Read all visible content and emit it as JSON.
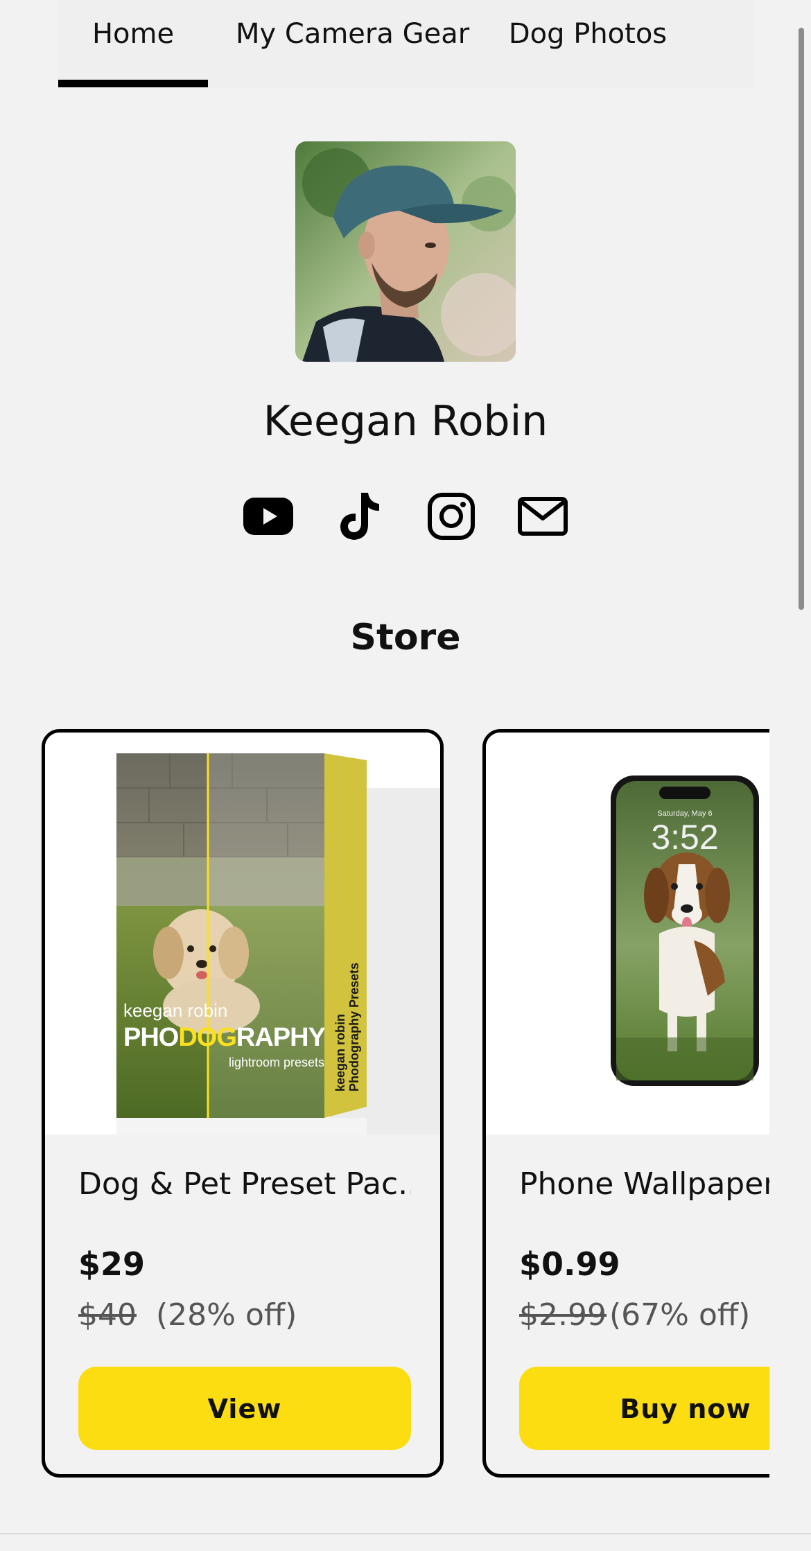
{
  "nav": {
    "tabs": [
      {
        "label": "Home",
        "active": true
      },
      {
        "label": "My Camera Gear",
        "active": false
      },
      {
        "label": "Dog Photos",
        "active": false
      }
    ]
  },
  "profile": {
    "name": "Keegan Robin",
    "socials": [
      "youtube-icon",
      "tiktok-icon",
      "instagram-icon",
      "mail-icon"
    ]
  },
  "store": {
    "title": "Store",
    "products": [
      {
        "title": "Dog & Pet Preset Pac...",
        "price": "$29",
        "original_price": "$40",
        "discount": "(28% off)",
        "button": "View",
        "image_text": {
          "brand": "keegan robin",
          "logo_a": "PHO",
          "logo_b": "DOG",
          "logo_c": "RAPHY",
          "sub": "lightroom presets",
          "spine_a": "keegan robin",
          "spine_b": "Phodography Presets"
        }
      },
      {
        "title": "Phone Wallpaper",
        "price": "$0.99",
        "original_price": "$2.99",
        "discount": "(67% off)",
        "button": "Buy now",
        "image_text": {
          "date": "Saturday, May 6",
          "time": "3:52"
        }
      }
    ]
  },
  "colors": {
    "background": "#f2f2f2",
    "accent_button": "#fcdd12",
    "text": "#111111"
  }
}
